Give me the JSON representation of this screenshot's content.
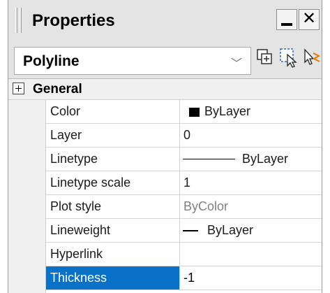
{
  "window": {
    "title": "Properties"
  },
  "object_selector": {
    "selected": "Polyline"
  },
  "category": {
    "label": "General",
    "expander_symbol": "⊟"
  },
  "properties": [
    {
      "name": "Color",
      "value": "ByLayer",
      "swatch_color": "#000000"
    },
    {
      "name": "Layer",
      "value": "0"
    },
    {
      "name": "Linetype",
      "value": "ByLayer"
    },
    {
      "name": "Linetype scale",
      "value": "1"
    },
    {
      "name": "Plot style",
      "value": "ByColor"
    },
    {
      "name": "Lineweight",
      "value": "ByLayer"
    },
    {
      "name": "Hyperlink",
      "value": ""
    },
    {
      "name": "Thickness",
      "value": "-1"
    }
  ],
  "colors": {
    "selection": "#0a71c9",
    "disabled_text": "#808080"
  },
  "icons": [
    "quick-select-icon",
    "select-objects-icon",
    "toggle-pickadd-icon"
  ]
}
